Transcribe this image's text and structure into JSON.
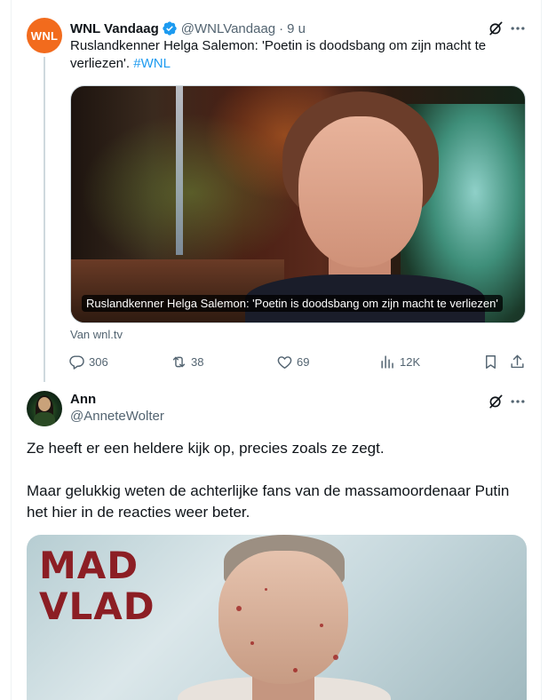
{
  "parent_tweet": {
    "avatar_text": "WNL",
    "author_name": "WNL Vandaag",
    "handle": "@WNLVandaag",
    "separator": "·",
    "time": "9 u",
    "text": "Ruslandkenner Helga Salemon: 'Poetin is doodsbang om zijn macht te verliezen'.",
    "hashtag": "#WNL",
    "media_caption": "Ruslandkenner Helga Salemon: 'Poetin is doodsbang om zijn macht te verliezen'",
    "source": "Van wnl.tv",
    "stats": {
      "replies": "306",
      "reposts": "38",
      "likes": "69",
      "views": "12K"
    }
  },
  "reply_tweet": {
    "author_name": "Ann",
    "handle": "@AnneteWolter",
    "paragraphs": [
      "Ze heeft er een heldere kijk op, precies zoals ze zegt.",
      "Maar gelukkig weten de achterlijke fans van de massamoordenaar Putin het hier in de reacties weer beter."
    ],
    "media_text_line1": "MAD",
    "media_text_line2": "VLAD"
  },
  "icons": {
    "verified": "verified-badge-icon",
    "grok": "grok-icon",
    "more": "more-icon",
    "reply": "reply-icon",
    "repost": "repost-icon",
    "like": "like-icon",
    "views": "views-icon",
    "bookmark": "bookmark-icon",
    "share": "share-icon"
  },
  "colors": {
    "accent": "#1d9bf0",
    "text_primary": "#0f1419",
    "text_secondary": "#536471",
    "wnl_brand": "#f26b1d",
    "mad_vlad_red": "#8c1e24"
  }
}
